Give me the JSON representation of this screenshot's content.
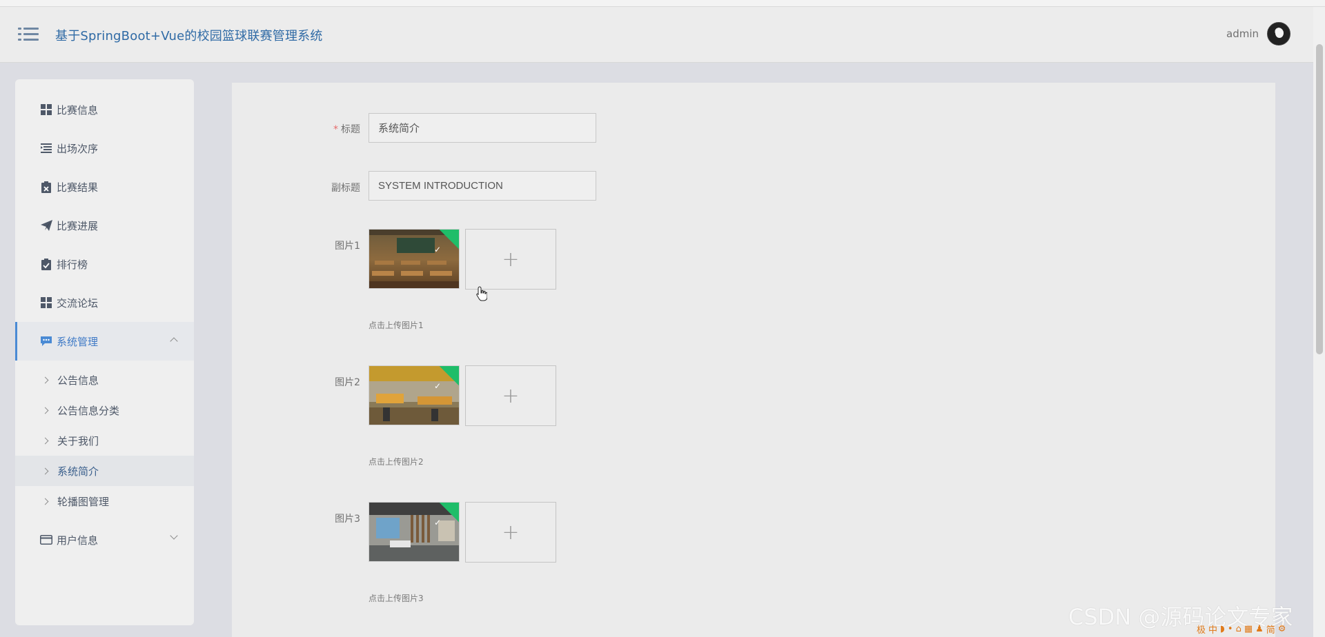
{
  "header": {
    "title": "基于SpringBoot+Vue的校园篮球联赛管理系统",
    "username": "admin"
  },
  "sidebar": {
    "items": [
      {
        "label": "比赛信息",
        "icon": "grid-icon"
      },
      {
        "label": "出场次序",
        "icon": "list-indent-icon"
      },
      {
        "label": "比赛结果",
        "icon": "clipboard-x-icon"
      },
      {
        "label": "比赛进展",
        "icon": "paper-plane-icon"
      },
      {
        "label": "排行榜",
        "icon": "clipboard-check-icon"
      },
      {
        "label": "交流论坛",
        "icon": "grid-icon"
      },
      {
        "label": "系统管理",
        "icon": "chat-bubble-icon",
        "expanded": true
      },
      {
        "label": "用户信息",
        "icon": "card-icon",
        "expanded": false
      }
    ],
    "submenu": [
      {
        "label": "公告信息"
      },
      {
        "label": "公告信息分类"
      },
      {
        "label": "关于我们"
      },
      {
        "label": "系统简介",
        "active": true
      },
      {
        "label": "轮播图管理"
      }
    ]
  },
  "form": {
    "title_label": "标题",
    "title_required_mark": "*",
    "title_value": "系统简介",
    "subtitle_label": "副标题",
    "subtitle_value": "SYSTEM INTRODUCTION",
    "images": [
      {
        "label": "图片1",
        "hint": "点击上传图片1"
      },
      {
        "label": "图片2",
        "hint": "点击上传图片2"
      },
      {
        "label": "图片3",
        "hint": "点击上传图片3"
      }
    ],
    "upload_plus": "+",
    "upload_status": "✓"
  },
  "overlay": {
    "watermark": "CSDN @源码论文专家",
    "tray": [
      "极",
      "中",
      "◗",
      "•",
      "⌂",
      "▦",
      "♟",
      "简",
      "⚙"
    ]
  },
  "colors": {
    "accent": "#4a8ad4",
    "title": "#2f6aa5",
    "success_corner": "#1fbd69",
    "required": "#e56b6b"
  }
}
